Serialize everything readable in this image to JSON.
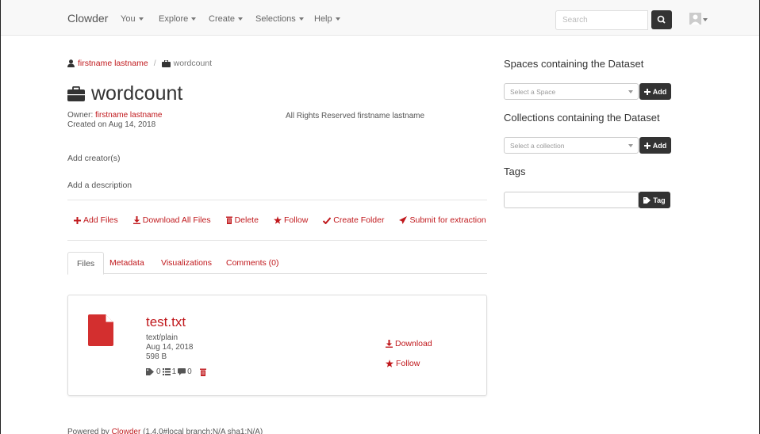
{
  "navbar": {
    "brand": "Clowder",
    "menus": [
      {
        "label": "You"
      },
      {
        "label": "Explore"
      },
      {
        "label": "Create"
      },
      {
        "label": "Selections"
      },
      {
        "label": "Help"
      }
    ],
    "search_placeholder": "Search"
  },
  "breadcrumb": {
    "user": "firstname lastname",
    "separator": "/",
    "dataset": "wordcount"
  },
  "dataset": {
    "title": "wordcount",
    "owner_label": "Owner:",
    "owner_name": "firstname lastname",
    "created": "Created on Aug 14, 2018",
    "license": "All Rights Reserved firstname lastname",
    "add_creators": "Add creator(s)",
    "add_description": "Add a description"
  },
  "actions": {
    "add_files": "Add Files",
    "download_all": "Download All Files",
    "delete": "Delete",
    "follow": "Follow",
    "create_folder": "Create Folder",
    "submit_extraction": "Submit for extraction"
  },
  "tabs": [
    {
      "label": "Files"
    },
    {
      "label": "Metadata"
    },
    {
      "label": "Visualizations"
    },
    {
      "label": "Comments (0)"
    }
  ],
  "file": {
    "name": "test.txt",
    "type": "text/plain",
    "date": "Aug 14, 2018",
    "size": "598 B",
    "tags_count": "0",
    "metadata_count": "1",
    "comments_count": "0",
    "download_label": "Download",
    "follow_label": "Follow"
  },
  "footer": {
    "prefix": "Powered by",
    "link": "Clowder",
    "version": "(1.4.0#local branch:N/A sha1:N/A)"
  },
  "sidebar": {
    "spaces_title": "Spaces containing the Dataset",
    "space_placeholder": "Select a Space",
    "collections_title": "Collections containing the Dataset",
    "collection_placeholder": "Select a collection",
    "add_label": "Add",
    "tags_title": "Tags",
    "tag_button": "Tag"
  },
  "colors": {
    "accent": "#c0181c",
    "dark_button": "#333333"
  }
}
